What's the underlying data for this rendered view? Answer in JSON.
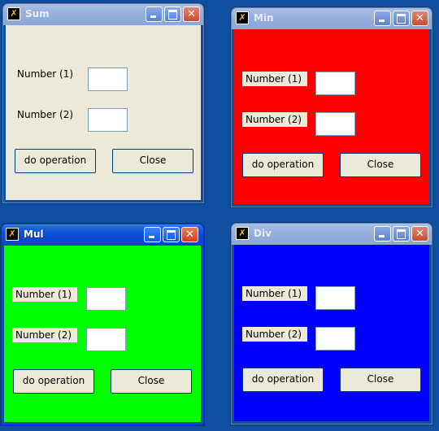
{
  "windows": {
    "sum": {
      "title": "Sum",
      "field1_label": "Number (1)",
      "field2_label": "Number (2)",
      "field1_value": "",
      "field2_value": "",
      "operation_button": "do operation",
      "close_button": "Close",
      "background_color": "#ece9d8"
    },
    "min": {
      "title": "Min",
      "field1_label": "Number (1)",
      "field2_label": "Number (2)",
      "field1_value": "",
      "field2_value": "",
      "operation_button": "do operation",
      "close_button": "Close",
      "background_color": "#ff0000"
    },
    "mul": {
      "title": "Mul",
      "field1_label": "Number (1)",
      "field2_label": "Number (2)",
      "field1_value": "",
      "field2_value": "",
      "operation_button": "do operation",
      "close_button": "Close",
      "background_color": "#00ff00"
    },
    "div": {
      "title": "Div",
      "field1_label": "Number (1)",
      "field2_label": "Number (2)",
      "field1_value": "",
      "field2_value": "",
      "operation_button": "do operation",
      "close_button": "Close",
      "background_color": "#0000ff"
    }
  },
  "desktop_color": "#0f4f9f",
  "active_window": "mul"
}
